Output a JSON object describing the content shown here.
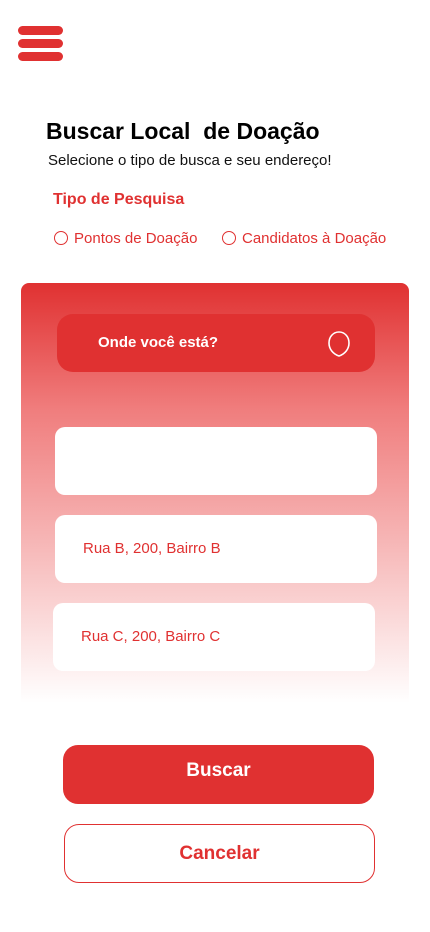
{
  "header": {
    "menu_icon": "hamburger-menu-icon"
  },
  "page": {
    "title": "Buscar Local  de Doação",
    "subtitle": "Selecione o tipo de busca e seu endereço!"
  },
  "search_type": {
    "label": "Tipo de Pesquisa",
    "options": [
      {
        "label": "Pontos de Doação",
        "selected": false
      },
      {
        "label": "Candidatos à Doação",
        "selected": false
      }
    ]
  },
  "location": {
    "label": "Onde você está?",
    "icon": "location-pin-icon"
  },
  "addresses": [
    "",
    "Rua B, 200, Bairro B",
    "Rua C, 200, Bairro C"
  ],
  "actions": {
    "search_label": "Buscar",
    "cancel_label": "Cancelar"
  },
  "colors": {
    "accent": "#e03131",
    "background": "#ffffff",
    "text_on_accent": "#ffffff"
  }
}
